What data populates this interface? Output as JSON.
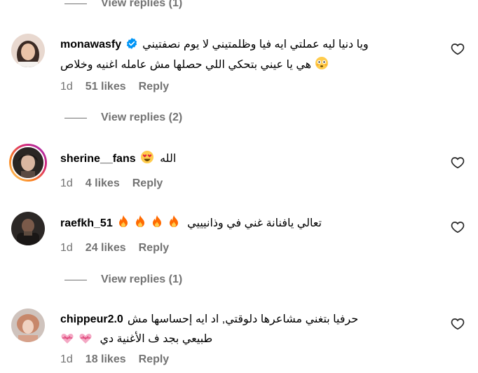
{
  "view_replies_top": {
    "label": "View replies (1)"
  },
  "comments": [
    {
      "username": "monawasfy",
      "verified": true,
      "text_line1": "ويا دنيا ليه عملتي ايه فيا وظلمتيني لا يوم نصفتيني",
      "text_line2": "هي يا عيني بتحكي اللي حصلها مش عامله اغنيه وخلاص",
      "emoji": "flushed-face-emoji",
      "time": "1d",
      "likes": "51 likes",
      "reply": "Reply",
      "view_replies": "View replies (2)"
    },
    {
      "username": "sherine__fans",
      "text": "الله",
      "emoji": "heart-eyes-emoji",
      "time": "1d",
      "likes": "4 likes",
      "reply": "Reply"
    },
    {
      "username": "raefkh_51",
      "text": "تعالي يافنانة غني في وذانيييي",
      "emoji": "fire-emoji",
      "time": "1d",
      "likes": "24 likes",
      "reply": "Reply",
      "view_replies": "View replies (1)"
    },
    {
      "username": "chippeur2.0",
      "text_line1": "حرفيا بتغني مشاعرها دلوقتي, اد ايه إحساسها مش",
      "text_line2": "طبيعي بجد ف الأغنية دي",
      "emoji": "heart-ribbon-emoji",
      "time": "1d",
      "likes": "18 likes",
      "reply": "Reply"
    }
  ],
  "colors": {
    "meta": "#737373",
    "verified": "#0095f6",
    "fire": "#ff6a00"
  },
  "icons": {
    "like": "heart-outline-icon",
    "verified": "verified-badge-icon"
  }
}
